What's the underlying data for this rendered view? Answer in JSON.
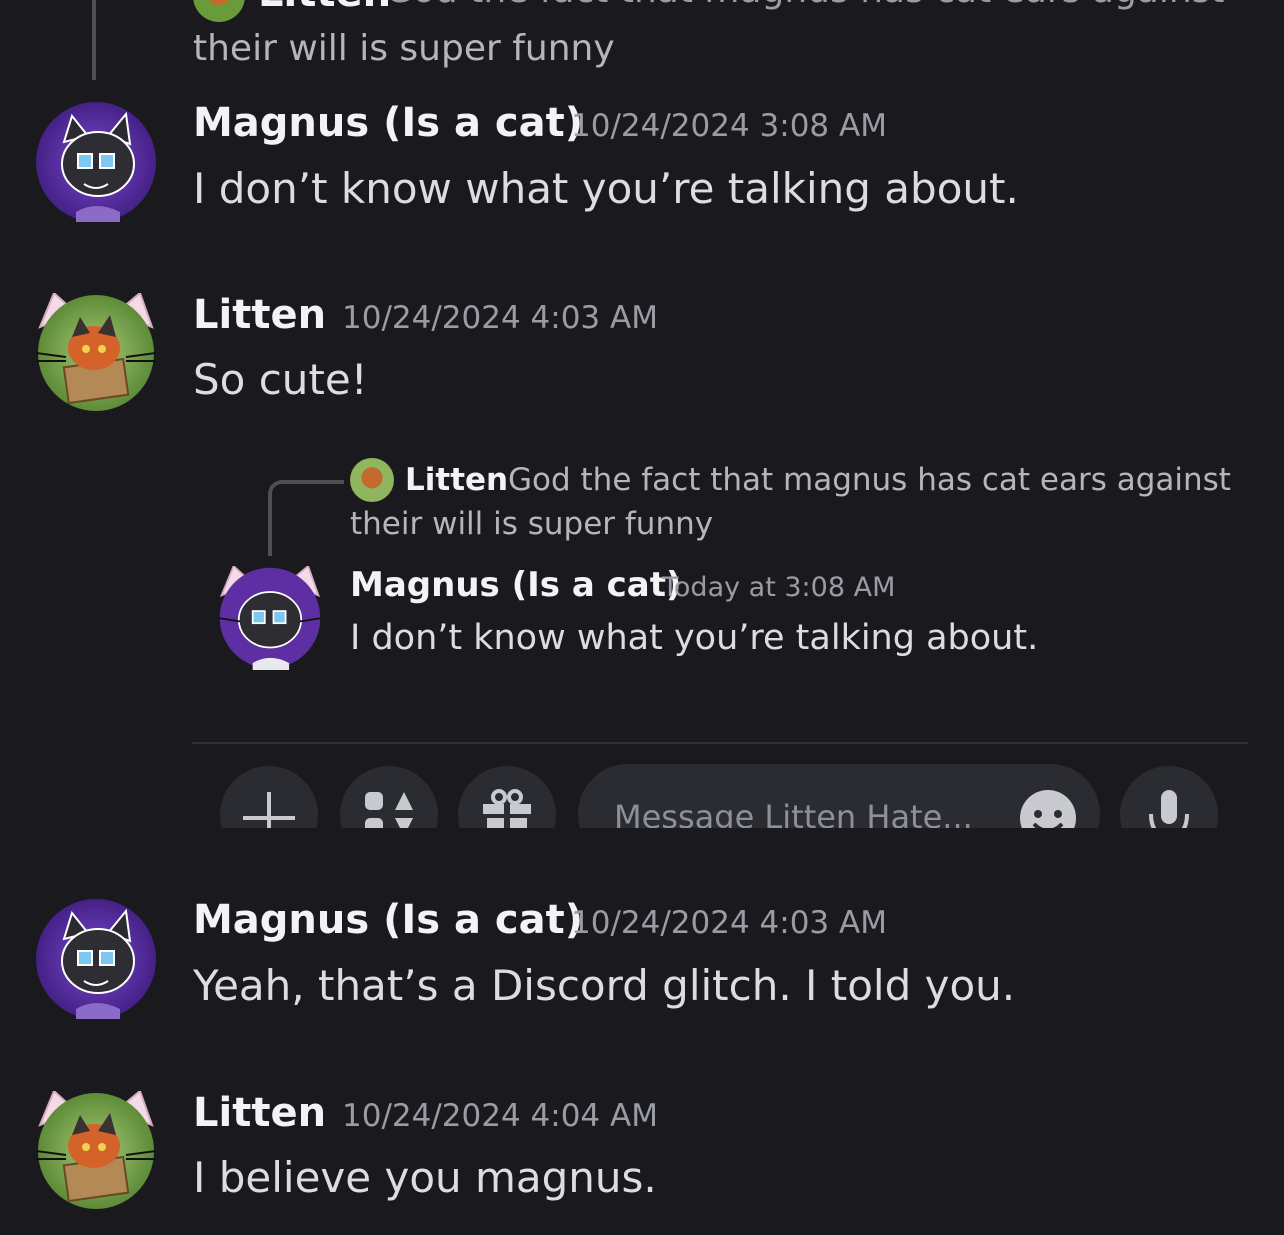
{
  "top_reply": {
    "author": "Litten",
    "text_line1": "God the fact that magnus has cat ears against",
    "text_line2": "their will is super funny"
  },
  "messages": [
    {
      "author": "Magnus (Is a cat)",
      "timestamp": "10/24/2024 3:08 AM",
      "text": "I don’t know what you’re talking about."
    },
    {
      "author": "Litten",
      "timestamp": "10/24/2024 4:03 AM",
      "text": "So cute!"
    },
    {
      "author": "Magnus (Is a cat)",
      "timestamp": "10/24/2024 4:03 AM",
      "text": "Yeah, that’s a Discord glitch. I told you."
    },
    {
      "author": "Litten",
      "timestamp": "10/24/2024 4:04 AM",
      "text": "I believe you magnus."
    }
  ],
  "embedded_screenshot": {
    "reply": {
      "author": "Litten",
      "text_line1": "God the fact that magnus has cat ears against",
      "text_line2": "their will is super funny"
    },
    "message": {
      "author": "Magnus (Is a cat)",
      "timestamp": "Today at 3:08 AM",
      "text": "I don’t know what you’re talking about."
    },
    "composer": {
      "placeholder": "Message Litten Hate..."
    }
  },
  "colors": {
    "background": "#1a1a1e",
    "username": "#f2f3f5",
    "timestamp": "#9a9ca5",
    "message_text": "#dcdde1",
    "avatar_magnus_bg": "#5a2fa0",
    "avatar_litten_bg": "#6a9b3a"
  },
  "icons": [
    "plus-icon",
    "apps-icon",
    "gift-icon",
    "emoji-icon",
    "microphone-icon"
  ]
}
